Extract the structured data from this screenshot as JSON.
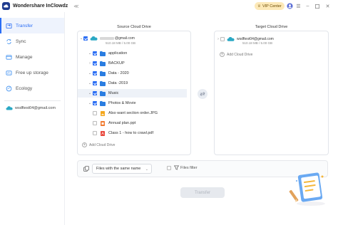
{
  "app": {
    "title": "Wondershare InClowdz",
    "vip_label": "VIP Center"
  },
  "sidebar": {
    "items": [
      {
        "label": "Transfer",
        "icon": "transfer-icon",
        "active": true
      },
      {
        "label": "Sync",
        "icon": "sync-icon",
        "active": false
      },
      {
        "label": "Manage",
        "icon": "manage-icon",
        "active": false
      },
      {
        "label": "Free up storage",
        "icon": "storage-icon",
        "active": false
      },
      {
        "label": "Ecology",
        "icon": "ecology-icon",
        "active": false
      }
    ],
    "account": "wsdftest04@gmail.com"
  },
  "source": {
    "title": "Source Cloud Drive",
    "account_email_suffix": "@gmail.com",
    "account_usage": "510.18 MB / 5.00 GB",
    "items": [
      {
        "name": "application",
        "type": "folder",
        "checked": true,
        "expand": true
      },
      {
        "name": "BACKUP",
        "type": "folder",
        "checked": true,
        "expand": false
      },
      {
        "name": "Data - 2020",
        "type": "folder",
        "checked": true,
        "expand": true
      },
      {
        "name": "Data -2019",
        "type": "folder",
        "checked": true,
        "expand": true
      },
      {
        "name": "Music",
        "type": "folder",
        "checked": true,
        "expand": true
      },
      {
        "name": "Photos & Movie",
        "type": "folder",
        "checked": true,
        "expand": true
      },
      {
        "name": "Also want section order.JPG",
        "type": "image",
        "checked": false,
        "expand": false
      },
      {
        "name": "Annual plan.ppt",
        "type": "ppt",
        "checked": false,
        "expand": false
      },
      {
        "name": "Class 1 - how to crawl.pdf",
        "type": "pdf",
        "checked": false,
        "expand": false
      }
    ],
    "add_label": "Add Cloud Drive"
  },
  "target": {
    "title": "Target Cloud Drive",
    "account_email": "wsdftest04@gmail.com",
    "account_usage": "510.18 MB / 5.00 GB",
    "add_label": "Add Cloud Drive"
  },
  "filter": {
    "select_value": "Files with the same name",
    "files_filter_label": "Files filter"
  },
  "transfer_label": "Transfer",
  "colors": {
    "accent": "#2a6df4",
    "folder": "#2a7de1"
  }
}
